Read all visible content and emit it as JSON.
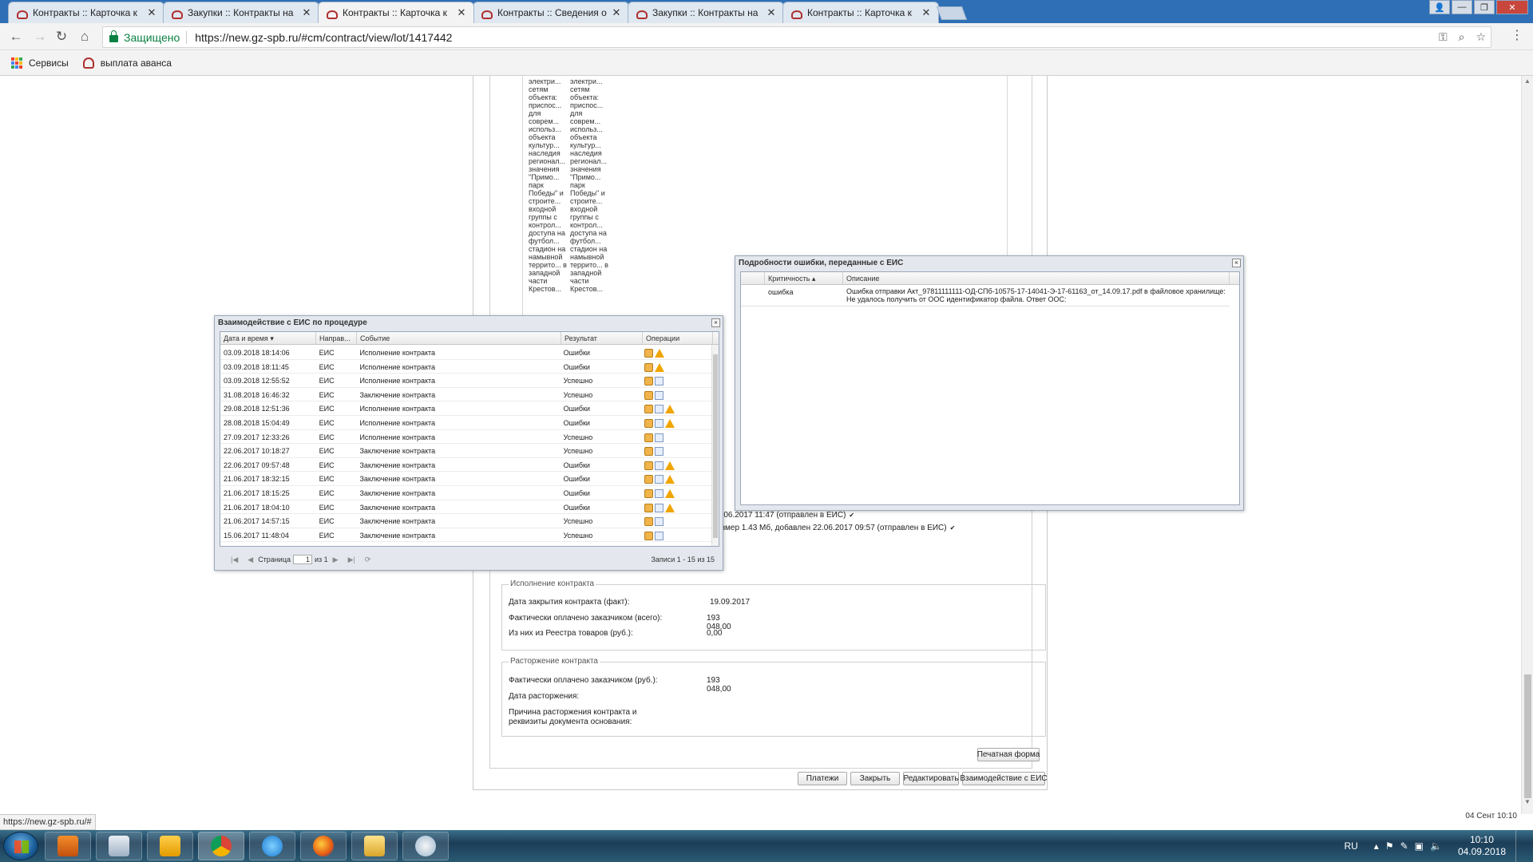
{
  "browser": {
    "tabs": [
      {
        "title": "Контракты :: Карточка к"
      },
      {
        "title": "Закупки :: Контракты на"
      },
      {
        "title": "Контракты :: Карточка к"
      },
      {
        "title": "Контракты :: Сведения о"
      },
      {
        "title": "Закупки :: Контракты на"
      },
      {
        "title": "Контракты :: Карточка к"
      }
    ],
    "secure_label": "Защищено",
    "url": "https://new.gz-spb.ru/#cm/contract/view/lot/1417442",
    "bookmarks": [
      {
        "label": "Сервисы"
      },
      {
        "label": "выплата аванса"
      }
    ],
    "status_url": "https://new.gz-spb.ru/#"
  },
  "page": {
    "text_col1": "электри... сетям объекта: приспос... для соврем... использ... объекта культур... наследия регионал... значения \"Примо... парк Победы\" и строите... входной группы с контрол... доступа на футбол... стадион на намывной террито... в западной части Крестов...",
    "text_col2": "электри... сетям объекта: приспос... для соврем... использ... объекта культур... наследия регионал... значения \"Примо... парк Победы\" и строите... входной группы с контрол... доступа на футбол... стадион на намывной террито... в западной части Крестов...",
    "doc_line1": "5.06.2017 11:47 (отправлен в ЕИС)",
    "doc_line2": "азмер 1.43 Мб, добавлен 22.06.2017 09:57 (отправлен в ЕИС)",
    "execution": {
      "legend": "Исполнение контракта",
      "rows": [
        {
          "label": "Дата закрытия контракта (факт):",
          "value": "19.09.2017"
        },
        {
          "label": "Фактически оплачено заказчиком (всего):",
          "value": "193 048,00"
        },
        {
          "label": "Из них из Реестра товаров (руб.):",
          "value": "0,00"
        }
      ]
    },
    "termination": {
      "legend": "Расторжение контракта",
      "rows": [
        {
          "label": "Фактически оплачено заказчиком (руб.):",
          "value": "193 048,00"
        },
        {
          "label": "Дата расторжения:",
          "value": ""
        },
        {
          "label": "Причина расторжения контракта и реквизиты документа основания:",
          "value": ""
        }
      ]
    },
    "buttons": {
      "print": "Печатная форма",
      "payments": "Платежи",
      "close": "Закрыть",
      "edit": "Редактировать",
      "eis": "Взаимодействие с ЕИС"
    },
    "bottom_date": "04 Сент 10:10"
  },
  "eis_dialog": {
    "title": "Взаимодействие с ЕИС по процедуре",
    "columns": [
      "Дата и время",
      "Направ...",
      "Событие",
      "Результат",
      "Операции"
    ],
    "rows": [
      {
        "dt": "03.09.2018 18:14:06",
        "dir": "ЕИС",
        "event": "Исполнение контракта",
        "result": "Ошибки",
        "ops": [
          "box",
          "warn"
        ]
      },
      {
        "dt": "03.09.2018 18:11:45",
        "dir": "ЕИС",
        "event": "Исполнение контракта",
        "result": "Ошибки",
        "ops": [
          "box",
          "warn"
        ]
      },
      {
        "dt": "03.09.2018 12:55:52",
        "dir": "ЕИС",
        "event": "Исполнение контракта",
        "result": "Успешно",
        "ops": [
          "box",
          "doc"
        ]
      },
      {
        "dt": "31.08.2018 16:46:32",
        "dir": "ЕИС",
        "event": "Заключение контракта",
        "result": "Успешно",
        "ops": [
          "box",
          "doc"
        ]
      },
      {
        "dt": "29.08.2018 12:51:36",
        "dir": "ЕИС",
        "event": "Исполнение контракта",
        "result": "Ошибки",
        "ops": [
          "box",
          "doc",
          "warn"
        ]
      },
      {
        "dt": "28.08.2018 15:04:49",
        "dir": "ЕИС",
        "event": "Исполнение контракта",
        "result": "Ошибки",
        "ops": [
          "box",
          "doc",
          "warn"
        ]
      },
      {
        "dt": "27.09.2017 12:33:26",
        "dir": "ЕИС",
        "event": "Исполнение контракта",
        "result": "Успешно",
        "ops": [
          "box",
          "doc"
        ]
      },
      {
        "dt": "22.06.2017 10:18:27",
        "dir": "ЕИС",
        "event": "Заключение контракта",
        "result": "Успешно",
        "ops": [
          "box",
          "doc"
        ]
      },
      {
        "dt": "22.06.2017 09:57:48",
        "dir": "ЕИС",
        "event": "Заключение контракта",
        "result": "Ошибки",
        "ops": [
          "box",
          "doc",
          "warn"
        ]
      },
      {
        "dt": "21.06.2017 18:32:15",
        "dir": "ЕИС",
        "event": "Заключение контракта",
        "result": "Ошибки",
        "ops": [
          "box",
          "doc",
          "warn"
        ]
      },
      {
        "dt": "21.06.2017 18:15:25",
        "dir": "ЕИС",
        "event": "Заключение контракта",
        "result": "Ошибки",
        "ops": [
          "box",
          "doc",
          "warn"
        ]
      },
      {
        "dt": "21.06.2017 18:04:10",
        "dir": "ЕИС",
        "event": "Заключение контракта",
        "result": "Ошибки",
        "ops": [
          "box",
          "doc",
          "warn"
        ]
      },
      {
        "dt": "21.06.2017 14:57:15",
        "dir": "ЕИС",
        "event": "Заключение контракта",
        "result": "Успешно",
        "ops": [
          "box",
          "doc"
        ]
      },
      {
        "dt": "15.06.2017 11:48:04",
        "dir": "ЕИС",
        "event": "Заключение контракта",
        "result": "Успешно",
        "ops": [
          "box",
          "doc"
        ]
      }
    ],
    "pager": {
      "page_label": "Страница",
      "page_value": "1",
      "of_label": "из 1",
      "records": "Записи 1 - 15 из 15"
    }
  },
  "error_dialog": {
    "title": "Подробности ошибки, переданные с ЕИС",
    "columns": [
      "Критичность",
      "Описание"
    ],
    "rows": [
      {
        "severity": "ошибка",
        "description": "Ошибка отправки Акт_97811111111-ОД-СПб-10575-17-14041-Э-17-61163_от_14.09.17.pdf в файловое хранилище: Не удалось получить от ООС идентификатор файла. Ответ ООС:"
      }
    ]
  },
  "taskbar": {
    "lang": "RU",
    "time": "10:10",
    "date": "04.09.2018"
  }
}
